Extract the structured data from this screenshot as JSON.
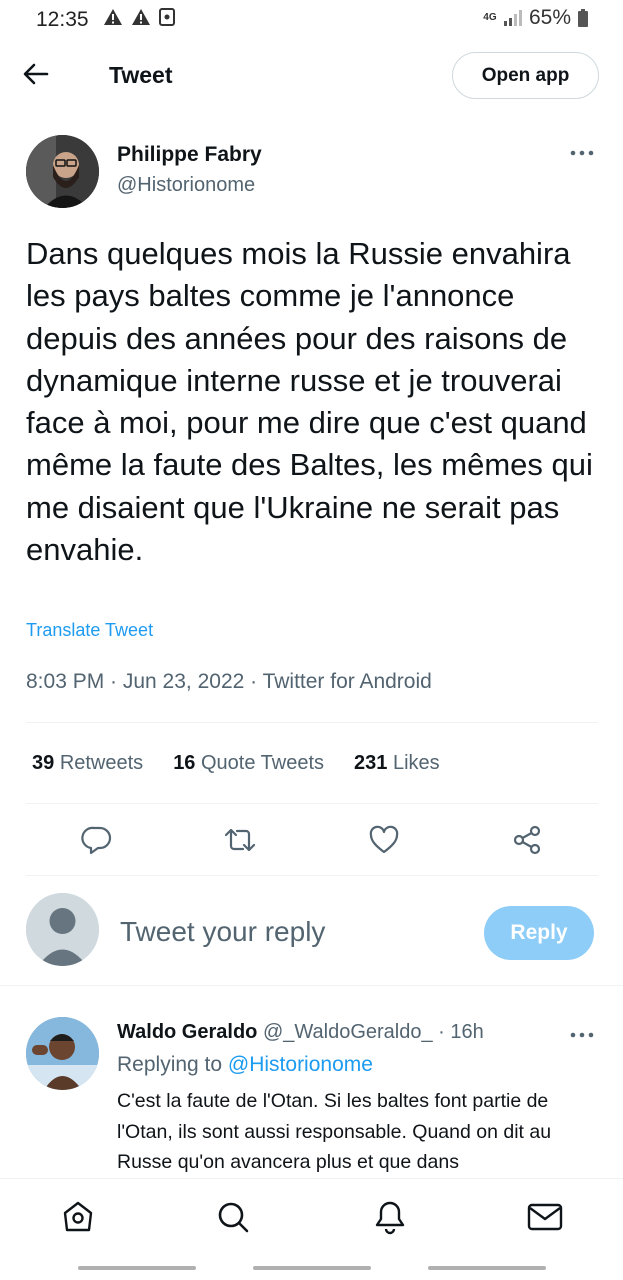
{
  "status_bar": {
    "time": "12:35",
    "network": "4G",
    "battery": "65%",
    "icons": [
      "warning-icon",
      "warning-icon",
      "screenshot-icon",
      "signal-icon",
      "battery-icon"
    ]
  },
  "header": {
    "title": "Tweet",
    "open_app_label": "Open app",
    "back_icon": "arrow-left-icon"
  },
  "tweet": {
    "author_name": "Philippe Fabry",
    "author_handle": "@Historionome",
    "text": "Dans quelques mois la Russie envahira les pays baltes comme je l'annonce depuis des années pour des raisons de dynamique interne russe et je trouverai face à moi, pour me dire que c'est quand même la faute des Baltes, les mêmes qui me disaient que l'Ukraine ne serait pas envahie.",
    "translate_label": "Translate Tweet",
    "meta": "8:03 PM · Jun 23, 2022 · Twitter for Android",
    "stats": {
      "retweets_count": "39",
      "retweets_label": "Retweets",
      "quotes_count": "16",
      "quotes_label": "Quote Tweets",
      "likes_count": "231",
      "likes_label": "Likes"
    },
    "actions": [
      "reply-icon",
      "retweet-icon",
      "like-icon",
      "share-icon"
    ]
  },
  "reply_box": {
    "placeholder": "Tweet your reply",
    "button_label": "Reply"
  },
  "reply_tweet": {
    "author_name": "Waldo Geraldo",
    "author_handle": "@_WaldoGeraldo_",
    "separator": "·",
    "time": "16h",
    "replying_prefix": "Replying to",
    "replying_handle": "@Historionome",
    "text": "C'est la faute de l'Otan. Si les baltes font partie de l'Otan, ils sont aussi responsable. Quand on dit au Russe qu'on avancera plus et que dans"
  },
  "bottom_nav": [
    "home-icon",
    "search-icon",
    "notifications-icon",
    "messages-icon"
  ],
  "colors": {
    "accent": "#1d9bf0",
    "reply_button": "#8ecdf8",
    "secondary_text": "#536471",
    "primary_text": "#0f1419"
  }
}
